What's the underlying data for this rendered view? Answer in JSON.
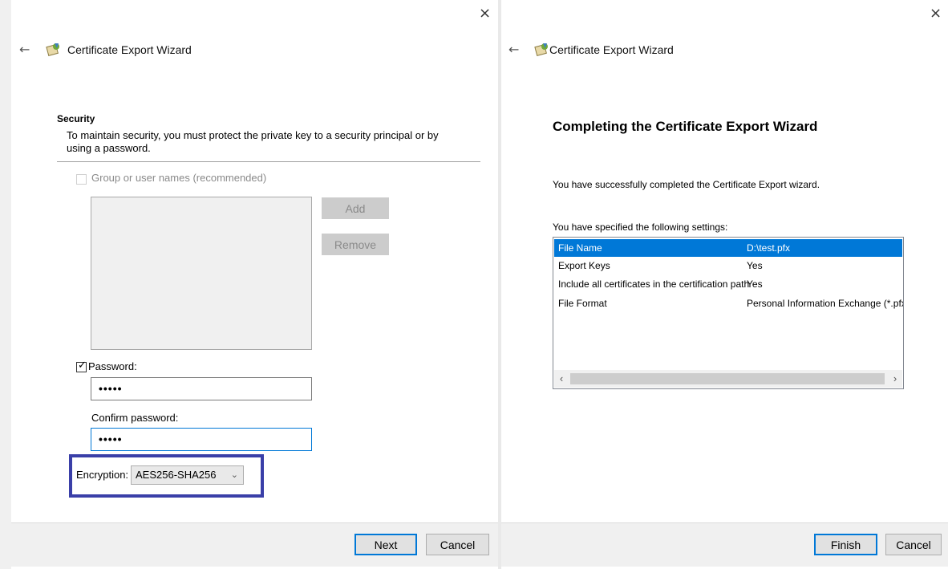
{
  "left_dialog": {
    "close_label": "×",
    "back_label": "←",
    "title": "Certificate Export Wizard",
    "section_title": "Security",
    "section_description": "To maintain security, you must protect the private key to a security principal or by using a password.",
    "group_checkbox_label": "Group or user names (recommended)",
    "add_button": "Add",
    "remove_button": "Remove",
    "password_checkbox_label": "Password:",
    "password_value": "•••••",
    "confirm_label": "Confirm password:",
    "confirm_value": "•••••",
    "encryption_label": "Encryption:",
    "encryption_value": "AES256-SHA256",
    "next_button": "Next",
    "cancel_button": "Cancel"
  },
  "right_dialog": {
    "close_label": "×",
    "back_label": "←",
    "title": "Certificate Export Wizard",
    "heading": "Completing the Certificate Export Wizard",
    "success_text": "You have successfully completed the Certificate Export wizard.",
    "settings_label": "You have specified the following settings:",
    "settings": [
      {
        "name": "File Name",
        "value": "D:\\test.pfx"
      },
      {
        "name": "Export Keys",
        "value": "Yes"
      },
      {
        "name": "Include all certificates in the certification path",
        "value": "Yes"
      },
      {
        "name": "File Format",
        "value": "Personal Information Exchange (*.pfx)"
      }
    ],
    "scroll_left": "‹",
    "scroll_right": "›",
    "finish_button": "Finish",
    "cancel_button": "Cancel"
  },
  "colors": {
    "accent": "#0078d7",
    "highlight_border": "#3a3fa8"
  }
}
